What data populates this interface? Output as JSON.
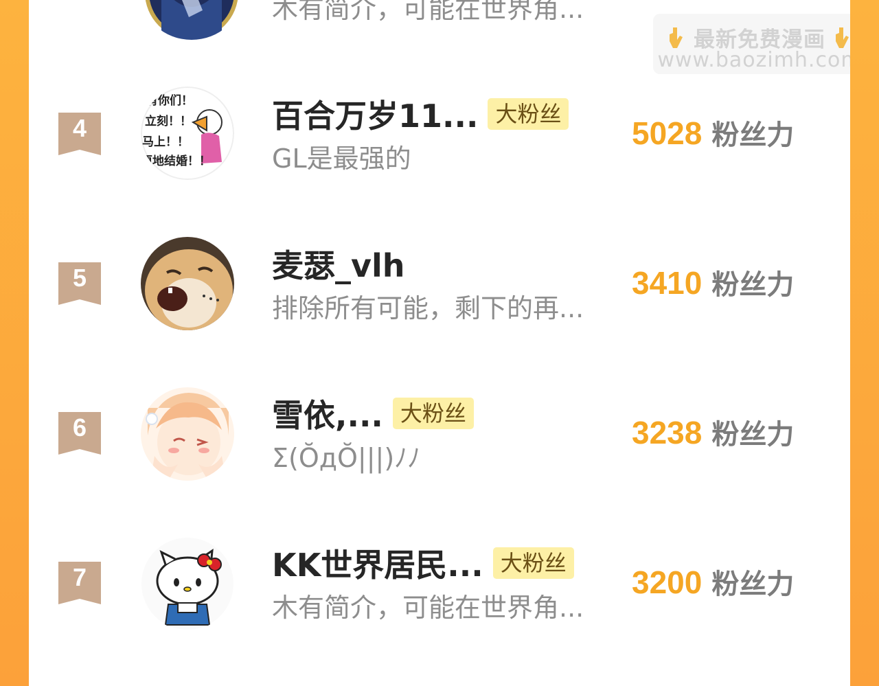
{
  "watermark": {
    "line1": "最新免费漫画",
    "line2": "www.baozimh.com"
  },
  "top_partial": {
    "bio": "木有简介，可能在世界角..."
  },
  "entries": [
    {
      "rank": "4",
      "name": "百合万岁11...",
      "badge": "大粉丝",
      "bio": "GL是最强的",
      "score": "5028",
      "score_label": "粉丝力",
      "avatar_text": [
        "有你们！",
        "立刻！！",
        "马上！！",
        "原地结婚！！"
      ]
    },
    {
      "rank": "5",
      "name": "麦瑟_vlh",
      "badge": "",
      "bio": "排除所有可能，剩下的再...",
      "score": "3410",
      "score_label": "粉丝力"
    },
    {
      "rank": "6",
      "name": "雪依,...",
      "badge": "大粉丝",
      "bio": "Σ(ŎдŎ|||)ﾉﾉ",
      "score": "3238",
      "score_label": "粉丝力"
    },
    {
      "rank": "7",
      "name": "KK世界居民...",
      "badge": "大粉丝",
      "bio": "木有简介，可能在世界角...",
      "score": "3200",
      "score_label": "粉丝力"
    }
  ],
  "colors": {
    "background_orange": "#fcab38",
    "score": "#f5a623",
    "badge_bg": "#fdf0a6",
    "rank_flag": "#c9a98f"
  }
}
